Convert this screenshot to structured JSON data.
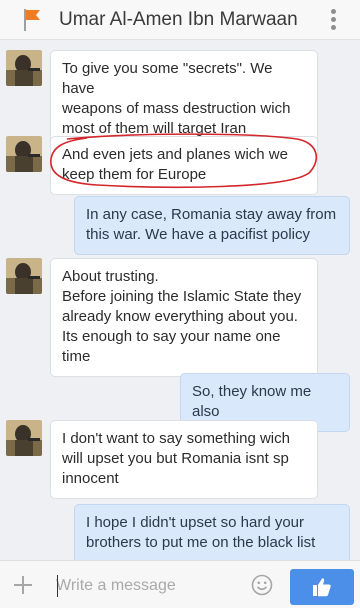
{
  "header": {
    "title": "Umar Al-Amen Ibn Marwaan",
    "flag_icon": "orange-flag-icon",
    "menu_icon": "kebab-menu-icon"
  },
  "messages": [
    {
      "direction": "incoming",
      "text": "To give you some \"secrets\". We have\nweapons of mass destruction wich\nmost of them will target Iran"
    },
    {
      "direction": "incoming",
      "text": "And even jets and planes wich we\nkeep them for Europe",
      "annotated": true
    },
    {
      "direction": "outgoing",
      "text": "In any case, Romania stay away from\nthis war. We have a pacifist policy"
    },
    {
      "direction": "incoming",
      "text": "About trusting.\nBefore joining the Islamic State they\nalready know everything about you.\nIts enough to say your name one\ntime"
    },
    {
      "direction": "outgoing",
      "text": "So, they know me also"
    },
    {
      "direction": "incoming",
      "text": "I don't want to say something wich\nwill upset you but Romania isnt sp\ninnocent"
    },
    {
      "direction": "outgoing",
      "text": "I hope I didn't upset so hard your\nbrothers to put me on the black list"
    }
  ],
  "composer": {
    "placeholder": "Write a message",
    "value": "",
    "attach_icon": "plus-icon",
    "emoji_icon": "smiley-icon",
    "send_icon": "thumbs-up-icon"
  },
  "colors": {
    "accent": "#4c8fe8",
    "outgoing_bubble": "#d9e8fb",
    "incoming_bubble": "#ffffff",
    "annotation": "#d4272b",
    "flag": "#f07b22"
  }
}
